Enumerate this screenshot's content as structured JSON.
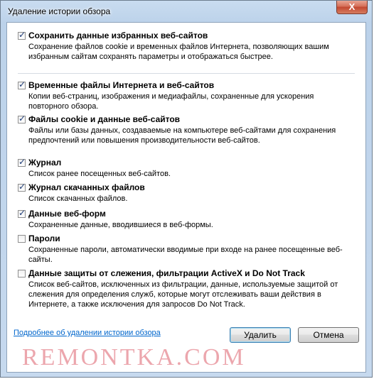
{
  "window": {
    "title": "Удаление истории обзора",
    "close_label": "X"
  },
  "items": [
    {
      "label": "Сохранить данные избранных веб-сайтов",
      "checked": true,
      "description": "Сохранение файлов cookie и временных файлов Интернета, позволяющих вашим избранным сайтам сохранять параметры и отображаться быстрее."
    },
    {
      "label": "Временные файлы Интернета и веб-сайтов",
      "checked": true,
      "description": "Копии веб-страниц, изображения и медиафайлы, сохраненные для ускорения повторного обзора."
    },
    {
      "label": "Файлы cookie и данные веб-сайтов",
      "checked": true,
      "description": "Файлы или базы данных, создаваемые на компьютере веб-сайтами для сохранения предпочтений или повышения производительности веб-сайтов."
    },
    {
      "label": "Журнал",
      "checked": true,
      "description": "Список ранее посещенных веб-сайтов."
    },
    {
      "label": "Журнал скачанных файлов",
      "checked": true,
      "description": "Список скачанных файлов."
    },
    {
      "label": "Данные веб-форм",
      "checked": true,
      "description": "Сохраненные данные, вводившиеся в веб-формы."
    },
    {
      "label": "Пароли",
      "checked": false,
      "description": "Сохраненные пароли, автоматически вводимые при входе на ранее посещенные веб-сайты."
    },
    {
      "label": "Данные защиты от слежения, фильтрации ActiveX и Do Not Track",
      "checked": false,
      "description": "Список веб-сайтов, исключенных из фильтрации, данные, используемые защитой от слежения для определения служб, которые могут отслеживать ваши действия в Интернете, а также исключения для запросов Do Not Track."
    }
  ],
  "footer": {
    "link_text": "Подробнее об удалении истории обзора",
    "delete_label": "Удалить",
    "cancel_label": "Отмена"
  },
  "watermark": "REMONTKA.COM"
}
